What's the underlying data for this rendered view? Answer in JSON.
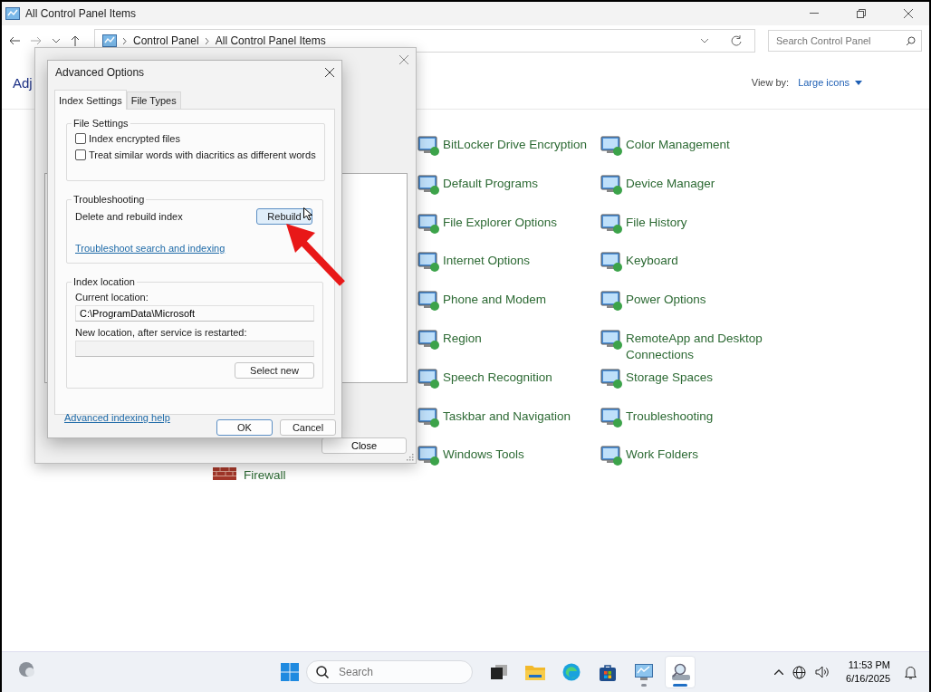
{
  "window": {
    "title": "All Control Panel Items",
    "breadcrumb": [
      "Control Panel",
      "All Control Panel Items"
    ],
    "search": {
      "placeholder": "Search Control Panel"
    }
  },
  "content": {
    "heading": "Adj",
    "view_by_label": "View by:",
    "view_by_value": "Large icons",
    "partial_item": "Firewall",
    "items": [
      "BitLocker Drive Encryption",
      "Color Management",
      "Default Programs",
      "Device Manager",
      "File Explorer Options",
      "File History",
      "Internet Options",
      "Keyboard",
      "Phone and Modem",
      "Power Options",
      "Region",
      "RemoteApp and Desktop Connections",
      "Speech Recognition",
      "Storage Spaces",
      "Taskbar and Navigation",
      "Troubleshooting",
      "Windows Tools",
      "Work Folders"
    ]
  },
  "indexing_dialog": {
    "buttons": [
      "Close"
    ]
  },
  "advanced_dialog": {
    "title": "Advanced Options",
    "tabs": [
      {
        "label": "Index Settings",
        "selected": true
      },
      {
        "label": "File Types",
        "selected": false
      }
    ],
    "file_settings": {
      "title": "File Settings",
      "options": [
        {
          "label": "Index encrypted files",
          "checked": false
        },
        {
          "label": "Treat similar words with diacritics as different words",
          "checked": false
        }
      ]
    },
    "troubleshooting": {
      "title": "Troubleshooting",
      "description": "Delete and rebuild index",
      "button": "Rebuild",
      "link": "Troubleshoot search and indexing"
    },
    "index_location": {
      "title": "Index location",
      "current_label": "Current location:",
      "current_value": "C:\\ProgramData\\Microsoft",
      "new_label": "New location, after service is restarted:",
      "button": "Select new"
    },
    "help_link": "Advanced indexing help",
    "buttons": [
      "OK",
      "Cancel"
    ]
  },
  "taskbar": {
    "search_placeholder": "Search",
    "time": "11:53 PM",
    "date": "6/16/2025",
    "apps": [
      {
        "kind": "task-view",
        "running": false,
        "selected": false
      },
      {
        "kind": "file-explorer",
        "running": false,
        "selected": false
      },
      {
        "kind": "edge",
        "running": false,
        "selected": false
      },
      {
        "kind": "store",
        "running": false,
        "selected": false
      },
      {
        "kind": "control-panel",
        "running": true,
        "selected": false
      },
      {
        "kind": "indexing",
        "running": true,
        "selected": true
      }
    ]
  }
}
